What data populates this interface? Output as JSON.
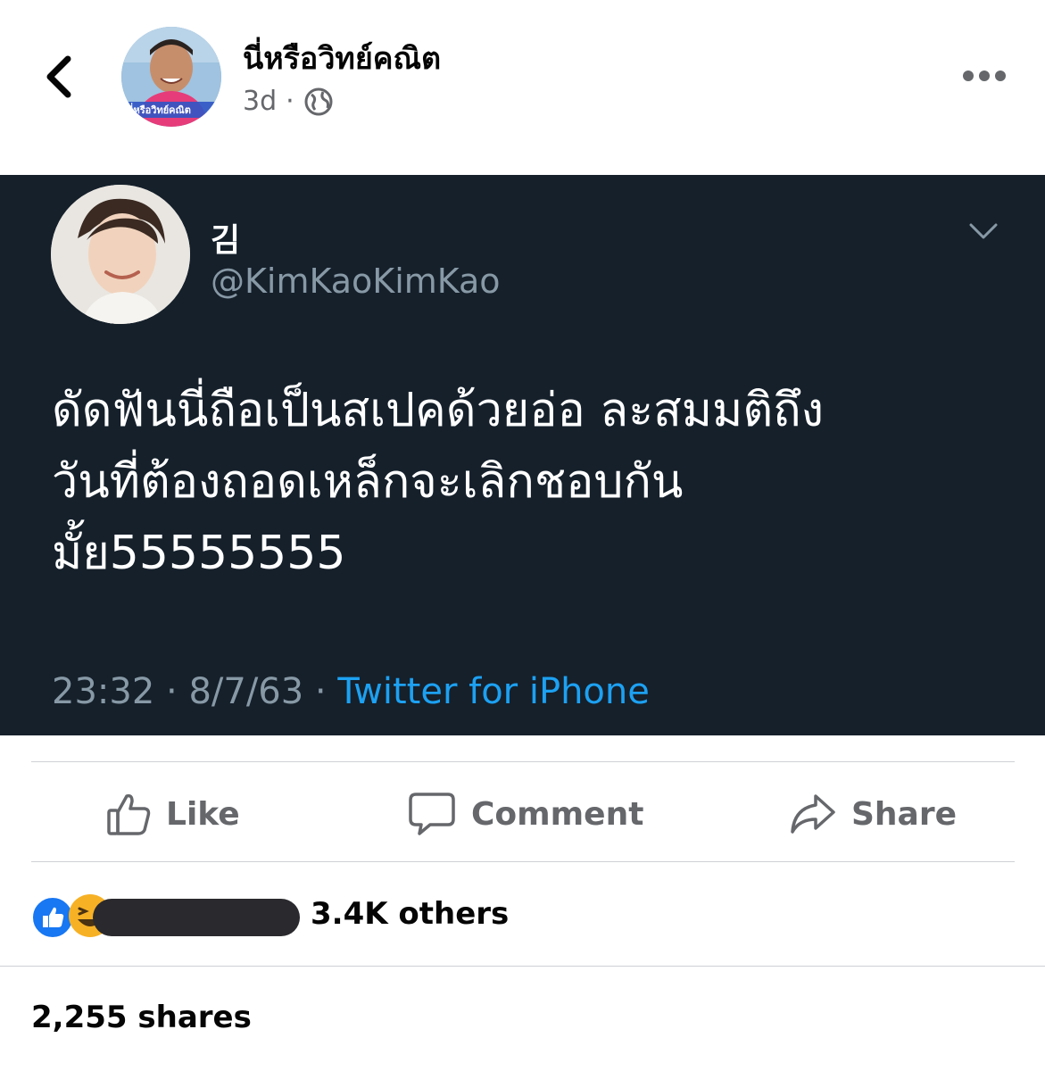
{
  "post": {
    "page_name": "นี่หรือวิทย์คณิต",
    "time": "3d",
    "separator": "·",
    "privacy_icon": "globe-icon",
    "avatar_caption": "นี่หรือวิทย์คณิต"
  },
  "tweet": {
    "name": "김",
    "handle": "@KimKaoKimKao",
    "text": "ดัดฟันนี่ถือเป็นสเปคด้วยอ่อ ละสมมติถึง\nวันที่ต้องถอดเหล็กจะเลิกชอบกัน\nมั้ย55555555",
    "time": "23:32",
    "date": "8/7/63",
    "source": "Twitter for iPhone",
    "separator": "·"
  },
  "actions": {
    "like": "Like",
    "comment": "Comment",
    "share": "Share"
  },
  "reactions": {
    "text": "3.4K others",
    "icons": [
      "like-reaction-icon",
      "haha-reaction-icon"
    ]
  },
  "shares_text": "2,255 shares",
  "colors": {
    "tweet_bg": "#15202b",
    "tweet_link": "#1da1f2",
    "tweet_muted": "#8899a6",
    "fb_blue": "#1877f2",
    "fb_muted": "#65676b"
  }
}
